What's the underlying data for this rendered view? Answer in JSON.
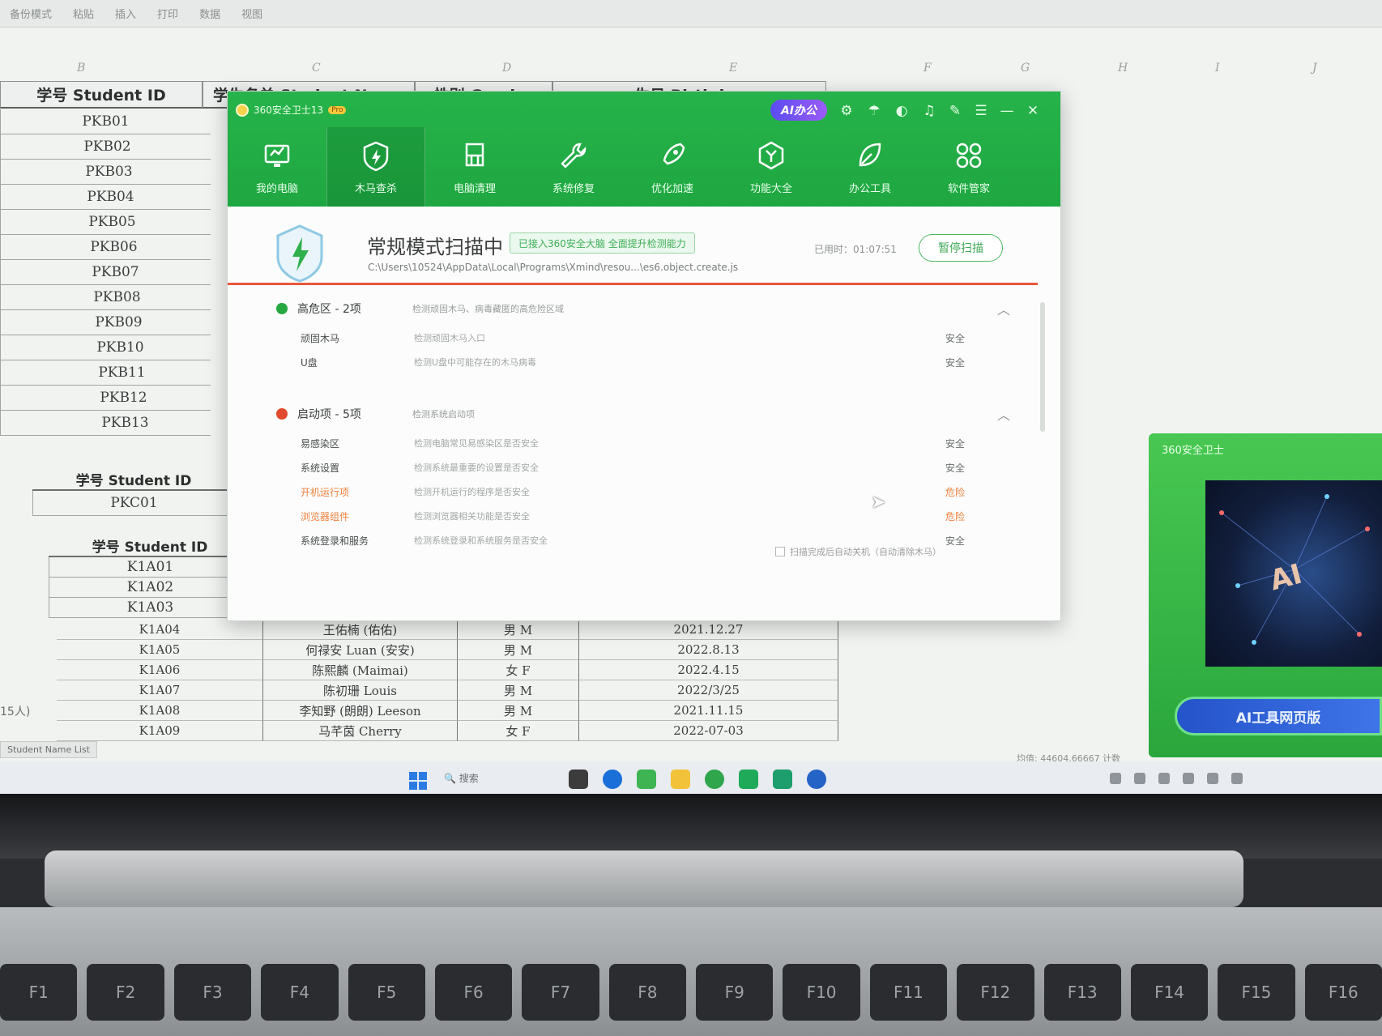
{
  "excel": {
    "toolbar_items": [
      "备份模式",
      "粘贴",
      "插入",
      "打印",
      "数据",
      "视图"
    ],
    "column_letters": [
      "B",
      "C",
      "D",
      "E",
      "F",
      "G",
      "H",
      "I",
      "J"
    ],
    "headers": {
      "student_id": "学号 Student ID",
      "student_name": "学生名单 Student Name",
      "gender": "性别 Gender",
      "birthday": "生日 Birthday"
    },
    "ids_pkb": [
      "PKB01",
      "PKB02",
      "PKB03",
      "PKB04",
      "PKB05",
      "PKB06",
      "PKB07",
      "PKB08",
      "PKB09",
      "PKB10",
      "PKB11",
      "PKB12",
      "PKB13"
    ],
    "pkc_header": "学号 Student ID",
    "ids_pkc": [
      "PKC01"
    ],
    "k1a_header": "学号 Student ID",
    "ids_k1a_top": [
      "K1A01",
      "K1A02",
      "K1A03"
    ],
    "rows_k1a": [
      {
        "id": "K1A04",
        "name": "王佑楠 (佑佑)",
        "gender": "男 M",
        "birthday": "2021.12.27"
      },
      {
        "id": "K1A05",
        "name": "何禄安 Luan (安安)",
        "gender": "男 M",
        "birthday": "2022.8.13"
      },
      {
        "id": "K1A06",
        "name": "陈熙麟 (Maimai)",
        "gender": "女 F",
        "birthday": "2022.4.15"
      },
      {
        "id": "K1A07",
        "name": "陈初珊 Louis",
        "gender": "男 M",
        "birthday": "2022/3/25"
      },
      {
        "id": "K1A08",
        "name": "李知野 (朗朗) Leeson",
        "gender": "男 M",
        "birthday": "2021.11.15"
      },
      {
        "id": "K1A09",
        "name": "马芊茵 Cherry",
        "gender": "女 F",
        "birthday": "2022-07-03"
      }
    ],
    "side_label": "15人)",
    "sheet_tab": "Student Name List",
    "status_text": "均值: 44604.66667  计数"
  },
  "security_app": {
    "title": "360安全卫士13",
    "badge": "Pro",
    "ai_button": "AI办公",
    "window_controls": [
      "minimize",
      "close"
    ],
    "nav": [
      {
        "label": "我的电脑",
        "icon": "monitor-icon"
      },
      {
        "label": "木马查杀",
        "icon": "shield-icon",
        "active": true
      },
      {
        "label": "电脑清理",
        "icon": "broom-icon"
      },
      {
        "label": "系统修复",
        "icon": "wrench-icon"
      },
      {
        "label": "优化加速",
        "icon": "rocket-icon"
      },
      {
        "label": "功能大全",
        "icon": "hexagon-icon"
      },
      {
        "label": "办公工具",
        "icon": "leaf-icon"
      },
      {
        "label": "软件管家",
        "icon": "grid-icon"
      }
    ],
    "scan": {
      "title": "常规模式扫描中",
      "tag": "已接入360安全大脑 全面提升检测能力",
      "path": "C:\\Users\\10524\\AppData\\Local\\Programs\\Xmind\\resou...\\es6.object.create.js",
      "elapsed_label": "已用时：",
      "elapsed": "01:07:51",
      "pause_button": "暂停扫描"
    },
    "groups": [
      {
        "title": "高危区 - 2项",
        "desc": "检测顽固木马、病毒藏匿的高危险区域",
        "status_color": "#27a843",
        "items": [
          {
            "name": "顽固木马",
            "desc": "检测顽固木马入口",
            "status": "安全",
            "warn": false
          },
          {
            "name": "U盘",
            "desc": "检测U盘中可能存在的木马病毒",
            "status": "安全",
            "warn": false
          }
        ]
      },
      {
        "title": "启动项 - 5项",
        "desc": "检测系统启动项",
        "status_color": "#e24a2f",
        "items": [
          {
            "name": "易感染区",
            "desc": "检测电脑常见易感染区是否安全",
            "status": "安全",
            "warn": false
          },
          {
            "name": "系统设置",
            "desc": "检测系统最重要的设置是否安全",
            "status": "安全",
            "warn": false
          },
          {
            "name": "开机运行项",
            "desc": "检测开机运行的程序是否安全",
            "status": "危险",
            "warn": true
          },
          {
            "name": "浏览器组件",
            "desc": "检测浏览器相关功能是否安全",
            "status": "危险",
            "warn": true
          },
          {
            "name": "系统登录和服务",
            "desc": "检测系统登录和系统服务是否安全",
            "status": "安全",
            "warn": false
          }
        ]
      }
    ],
    "auto_shutdown": "扫描完成后自动关机（自动清除木马）"
  },
  "ad": {
    "title": "360安全卫士",
    "visual_text": "AI",
    "button": "AI工具网页版"
  },
  "taskbar": {
    "search_placeholder": "搜索"
  },
  "keyboard": [
    "F1",
    "F2",
    "F3",
    "F4",
    "F5",
    "F6",
    "F7",
    "F8",
    "F9",
    "F10",
    "F11",
    "F12",
    "F13",
    "F14",
    "F15",
    "F16"
  ]
}
